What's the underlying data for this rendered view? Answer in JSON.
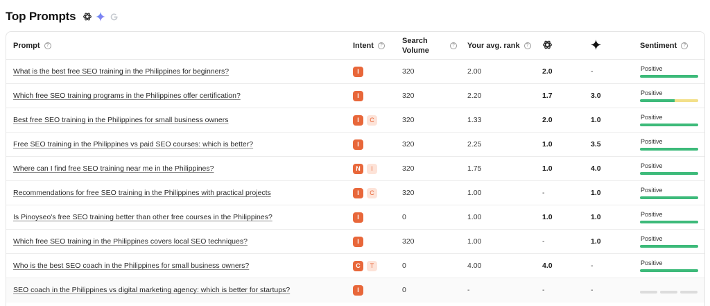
{
  "header": {
    "title": "Top Prompts",
    "engines": [
      "chatgpt-icon",
      "gemini-icon",
      "google-icon"
    ]
  },
  "columns": {
    "prompt": "Prompt",
    "intent": "Intent",
    "search_volume": [
      "Search",
      "Volume"
    ],
    "avg_rank": "Your avg. rank",
    "chatgpt": "chatgpt-icon",
    "gemini": "gemini-icon",
    "sentiment": "Sentiment"
  },
  "colors": {
    "intent_badge": "#e8673a",
    "intent_badge_secondary_bg": "#fde3d8",
    "sentiment_positive": "#3dba7a",
    "sentiment_neutral": "#f3e08a"
  },
  "rows": [
    {
      "prompt": "What is the best free SEO training in the Philippines for beginners?",
      "intents": [
        "I"
      ],
      "volume": "320",
      "avg_rank": "2.00",
      "chatgpt": "2.0",
      "gemini": "-",
      "sentiment": "Positive",
      "positive_share": 1.0,
      "neutral_share": 0.0
    },
    {
      "prompt": "Which free SEO training programs in the Philippines offer certification?",
      "intents": [
        "I"
      ],
      "volume": "320",
      "avg_rank": "2.20",
      "chatgpt": "1.7",
      "gemini": "3.0",
      "sentiment": "Positive",
      "positive_share": 0.6,
      "neutral_share": 0.4
    },
    {
      "prompt": "Best free SEO training in the Philippines for small business owners",
      "intents": [
        "I",
        "C"
      ],
      "volume": "320",
      "avg_rank": "1.33",
      "chatgpt": "2.0",
      "gemini": "1.0",
      "sentiment": "Positive",
      "positive_share": 1.0,
      "neutral_share": 0.0
    },
    {
      "prompt": "Free SEO training in the Philippines vs paid SEO courses: which is better?",
      "intents": [
        "I"
      ],
      "volume": "320",
      "avg_rank": "2.25",
      "chatgpt": "1.0",
      "gemini": "3.5",
      "sentiment": "Positive",
      "positive_share": 1.0,
      "neutral_share": 0.0
    },
    {
      "prompt": "Where can I find free SEO training near me in the Philippines?",
      "intents": [
        "N",
        "I"
      ],
      "volume": "320",
      "avg_rank": "1.75",
      "chatgpt": "1.0",
      "gemini": "4.0",
      "sentiment": "Positive",
      "positive_share": 1.0,
      "neutral_share": 0.0
    },
    {
      "prompt": "Recommendations for free SEO training in the Philippines with practical projects",
      "intents": [
        "I",
        "C"
      ],
      "volume": "320",
      "avg_rank": "1.00",
      "chatgpt": "-",
      "gemini": "1.0",
      "sentiment": "Positive",
      "positive_share": 1.0,
      "neutral_share": 0.0
    },
    {
      "prompt": "Is Pinoyseo's free SEO training better than other free courses in the Philippines?",
      "intents": [
        "I"
      ],
      "volume": "0",
      "avg_rank": "1.00",
      "chatgpt": "1.0",
      "gemini": "1.0",
      "sentiment": "Positive",
      "positive_share": 1.0,
      "neutral_share": 0.0
    },
    {
      "prompt": "Which free SEO training in the Philippines covers local SEO techniques?",
      "intents": [
        "I"
      ],
      "volume": "320",
      "avg_rank": "1.00",
      "chatgpt": "-",
      "gemini": "1.0",
      "sentiment": "Positive",
      "positive_share": 1.0,
      "neutral_share": 0.0
    },
    {
      "prompt": "Who is the best SEO coach in the Philippines for small business owners?",
      "intents": [
        "C",
        "T"
      ],
      "volume": "0",
      "avg_rank": "4.00",
      "chatgpt": "4.0",
      "gemini": "-",
      "sentiment": "Positive",
      "positive_share": 1.0,
      "neutral_share": 0.0
    },
    {
      "prompt": "SEO coach in the Philippines vs digital marketing agency: which is better for startups?",
      "intents": [
        "I"
      ],
      "volume": "0",
      "avg_rank": "-",
      "chatgpt": "-",
      "gemini": "-",
      "sentiment": "",
      "positive_share": 0.0,
      "neutral_share": 0.0
    }
  ]
}
